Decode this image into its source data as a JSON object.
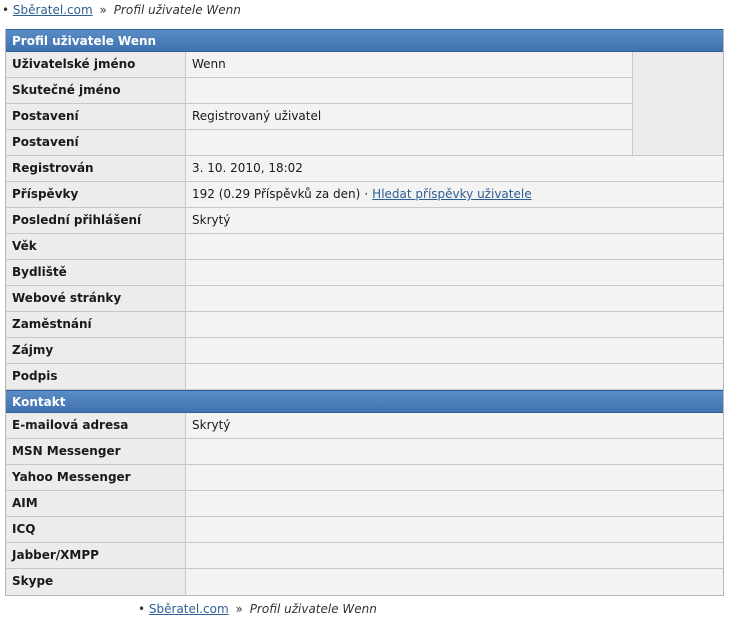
{
  "breadcrumb": {
    "bullet": "•",
    "home_link": "Sběratel.com",
    "separator": "»",
    "current": "Profil uživatele Wenn"
  },
  "profile_section": {
    "title": "Profil uživatele Wenn",
    "rows": [
      {
        "label": "Uživatelské jméno",
        "value": "Wenn"
      },
      {
        "label": "Skutečné jméno",
        "value": ""
      },
      {
        "label": "Postavení",
        "value": "Registrovaný uživatel"
      },
      {
        "label": "Postavení",
        "value": ""
      },
      {
        "label": "Registrován",
        "value": "3. 10. 2010, 18:02"
      },
      {
        "label": "Příspěvky",
        "value": "192 (0.29 Příspěvků za den)",
        "separator": "·",
        "link": "Hledat příspěvky uživatele"
      },
      {
        "label": "Poslední přihlášení",
        "value": "Skrytý"
      },
      {
        "label": "Věk",
        "value": ""
      },
      {
        "label": "Bydliště",
        "value": ""
      },
      {
        "label": "Webové stránky",
        "value": ""
      },
      {
        "label": "Zaměstnání",
        "value": ""
      },
      {
        "label": "Zájmy",
        "value": ""
      },
      {
        "label": "Podpis",
        "value": ""
      }
    ]
  },
  "contact_section": {
    "title": "Kontakt",
    "rows": [
      {
        "label": "E-mailová adresa",
        "value": "Skrytý"
      },
      {
        "label": "MSN Messenger",
        "value": ""
      },
      {
        "label": "Yahoo Messenger",
        "value": ""
      },
      {
        "label": "AIM",
        "value": ""
      },
      {
        "label": "ICQ",
        "value": ""
      },
      {
        "label": "Jabber/XMPP",
        "value": ""
      },
      {
        "label": "Skype",
        "value": ""
      }
    ]
  }
}
